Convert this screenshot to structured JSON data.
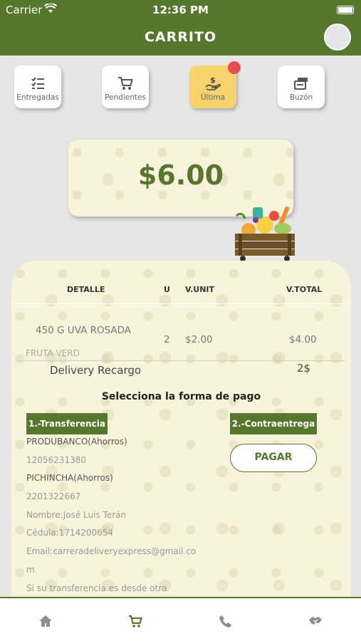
{
  "status": {
    "carrier": "Carrier",
    "time": "12:36 PM"
  },
  "header": {
    "title": "CARRITO"
  },
  "tabs": [
    {
      "label": "Entregadas",
      "icon": "checklist-icon"
    },
    {
      "label": "Pendientes",
      "icon": "cart-icon"
    },
    {
      "label": "Última",
      "icon": "hand-money-icon",
      "active": true
    },
    {
      "label": "Buzón",
      "icon": "inbox-icon"
    }
  ],
  "total": {
    "amount": "$6.00"
  },
  "table": {
    "headers": {
      "detalle": "DETALLE",
      "u": "U",
      "vunit": "V.UNIT",
      "vtotal": "V.TOTAL"
    },
    "items": [
      {
        "name": "450 G UVA ROSADA",
        "category": "FRUTA VERD",
        "u": "2",
        "vunit": "$2.00",
        "vtotal": "$4.00"
      }
    ],
    "delivery": {
      "label": "Delivery Recargo",
      "value": "2$"
    }
  },
  "payment": {
    "title": "Selecciona la forma de pago",
    "option1": "1.-Transferencia",
    "option2": "2.-Contraentrega",
    "pay_button": "PAGAR",
    "bank1_name": "PRODUBANCO(Ahorros)",
    "bank1_account": "12056231380",
    "bank2_name": "PICHINCHA(Ahorros)",
    "bank2_account": "2201322667",
    "nombre": "Nombre:José Luis Terán",
    "cedula": "Cédula:1714200654",
    "email_line1": "Email:carreradeliveryexpress@gmail.co",
    "email_line2": "m",
    "note": "Si su transferencia es desde otra"
  },
  "nav": [
    "home-icon",
    "cart-icon",
    "phone-icon",
    "handshake-icon"
  ],
  "colors": {
    "brand_green": "#57772e",
    "active_tab": "#f7d46b",
    "badge": "#e94e57",
    "cream": "#faf3db"
  }
}
